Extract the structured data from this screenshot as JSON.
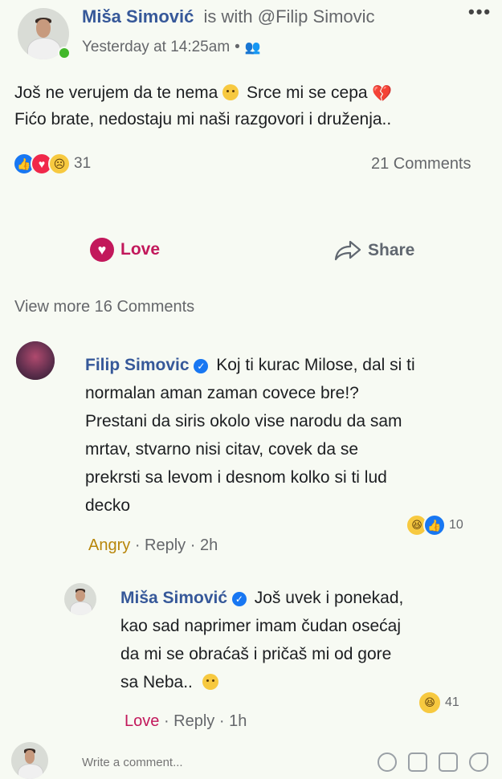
{
  "post": {
    "author": "Miša Simović",
    "with_text": "is with @Filip Simovic",
    "timestamp": "Yesterday at 14:25am",
    "audience_icon": "friends-icon",
    "more_icon": "more-dots-icon",
    "text_line1": "Još ne verujem da te nema",
    "text_line1b": "Srce mi se cepa",
    "text_line2": "Fićo brate, nedostaju mi naši razgovori i druženja..",
    "reaction_count": "31",
    "comments_count": "21 Comments",
    "actions": {
      "love": "Love",
      "share": "Share"
    }
  },
  "comments_section": {
    "view_more": "View more 16 Comments",
    "comments": [
      {
        "author": "Filip Simovic",
        "verified": true,
        "text_lines": [
          "Koj ti kurac Milose, dal si ti",
          "normalan aman zaman covece bre!?",
          "Prestani da siris okolo vise narodu da sam",
          "mrtav, stvarno nisi citav, covek da se",
          "prekrsti sa levom i desnom kolko si ti lud",
          "decko"
        ],
        "reaction_count": "10",
        "reaction_label": "Angry",
        "reply_label": "Reply",
        "time": "2h"
      },
      {
        "author": "Miša Simović",
        "verified": true,
        "text_lines": [
          "Još uvek i ponekad,",
          "kao sad naprimer imam čudan osećaj",
          "da mi se obraćaš i pričaš mi od gore",
          "sa Neba.."
        ],
        "reaction_count": "41",
        "reaction_label": "Love",
        "reply_label": "Reply",
        "time": "1h"
      }
    ]
  },
  "composer": {
    "placeholder": "Write a comment..."
  },
  "colors": {
    "link": "#365899",
    "love": "#c2185b",
    "angry": "#b8860b"
  }
}
